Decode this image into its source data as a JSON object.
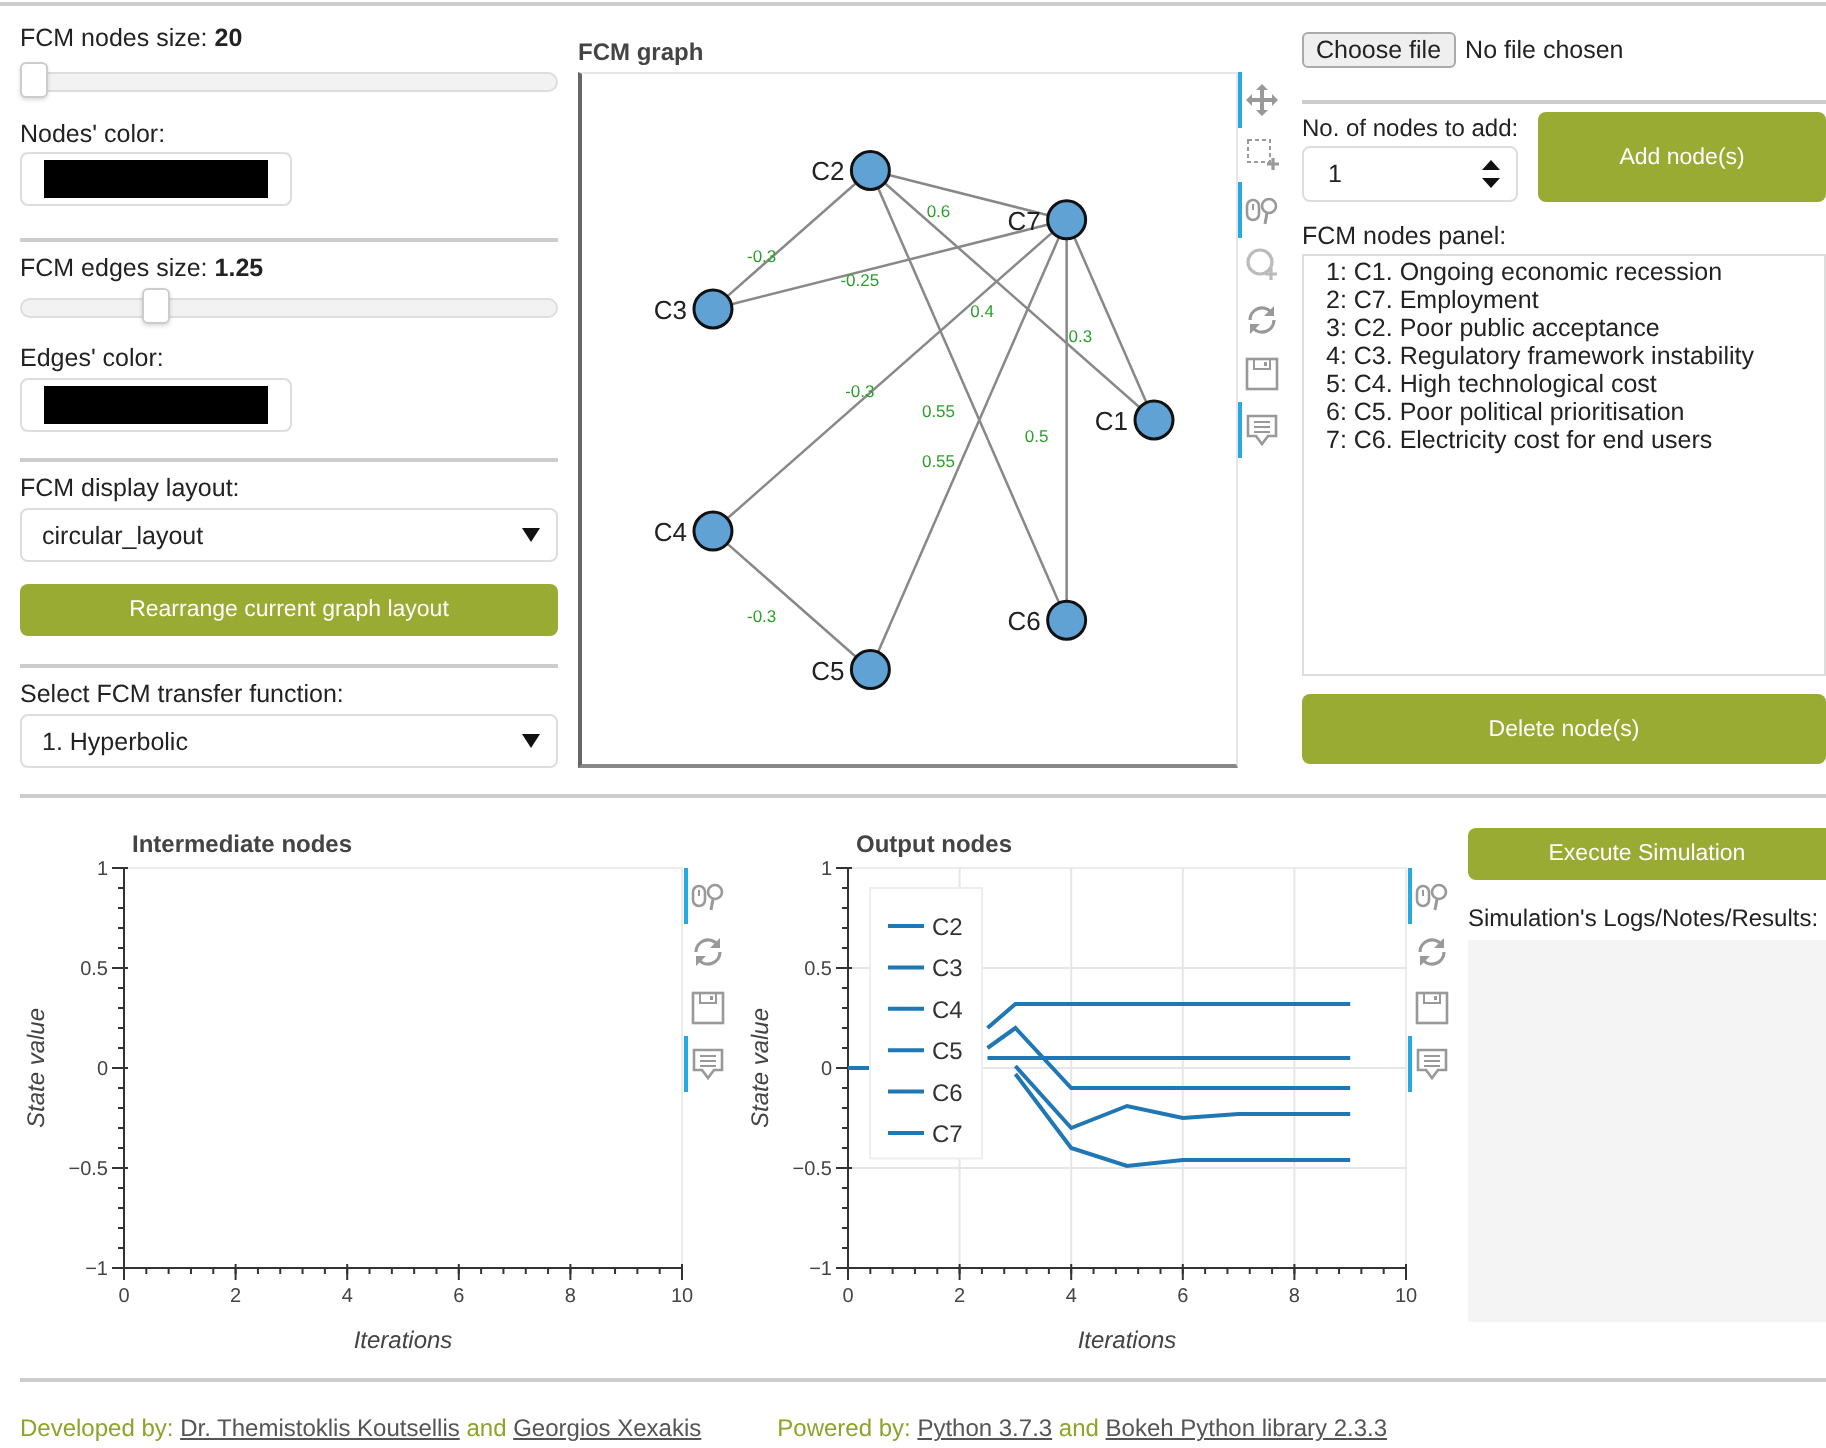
{
  "controls": {
    "node_size": {
      "label": "FCM nodes size: **20**",
      "level": 0.0
    },
    "node_color": {
      "label": "Nodes' color:",
      "color": "#000000"
    },
    "edge_size": {
      "label": "FCM edges size: **1.25**",
      "level": 0.24
    },
    "edge_color": {
      "label": "Edges' color:",
      "color": "#000000"
    },
    "layout": {
      "label": "FCM display layout:",
      "value": "circular_layout"
    },
    "rearrange_button": "Rearrange current graph layout",
    "transfer": {
      "label": "Select FCM transfer function:",
      "value": "1. Hyperbolic"
    }
  },
  "graph": {
    "title": "FCM graph",
    "nodes": [
      {
        "label": "C1"
      },
      {
        "label": "C7"
      },
      {
        "label": "C2"
      },
      {
        "label": "C3"
      },
      {
        "label": "C4"
      },
      {
        "label": "C5"
      },
      {
        "label": "C6"
      }
    ],
    "edges": [
      {
        "label": "-0.3"
      },
      {
        "label": "-0.25"
      },
      {
        "label": "0.6"
      },
      {
        "label": "0.4"
      },
      {
        "label": "0.3"
      },
      {
        "label": "-0.3"
      },
      {
        "label": "0.55"
      },
      {
        "label": "0.55"
      },
      {
        "label": "0.5"
      },
      {
        "label": "-0.3"
      }
    ],
    "tools": [
      {
        "kind": "pan",
        "active": true
      },
      {
        "kind": "box_zoom",
        "active": false
      },
      {
        "kind": "wheel_zoom",
        "active": true
      },
      {
        "kind": "zoom_in",
        "active": false
      },
      {
        "kind": "reset",
        "active": false
      },
      {
        "kind": "save",
        "active": false
      },
      {
        "kind": "hover",
        "active": true
      }
    ]
  },
  "file": {
    "button": "Choose file",
    "status": "No file chosen"
  },
  "add_nodes": {
    "label": "No. of nodes to add:",
    "value": "1",
    "button": "Add node(s)"
  },
  "nodes_panel": {
    "label": "FCM nodes panel:",
    "items": [
      {
        "text": "1: C1. Ongoing economic recession",
        "selected": false
      },
      {
        "text": "2: C7. Employment",
        "selected": false
      },
      {
        "text": "3: C2. Poor public acceptance",
        "selected": false
      },
      {
        "text": "4: C3. Regulatory framework instability",
        "selected": false
      },
      {
        "text": "5: C4. High technological cost",
        "selected": false
      },
      {
        "text": "6: C5. Poor political prioritisation",
        "selected": false
      },
      {
        "text": "7: C6. Electricity cost for end users",
        "selected": false
      }
    ]
  },
  "delete_button": "Delete node(s)",
  "plots": [
    {
      "tools": [
        {
          "kind": "wheel_zoom",
          "active": true
        },
        {
          "kind": "reset",
          "active": false
        },
        {
          "kind": "save",
          "active": false
        },
        {
          "kind": "hover",
          "active": true
        }
      ],
      "chart_data": {
        "type": "line",
        "title": "Intermediate nodes",
        "xlabel": "Iterations",
        "ylabel": "State value",
        "xlim": [
          0,
          10
        ],
        "ylim": [
          -1,
          1
        ],
        "xticks": [
          0,
          2,
          4,
          6,
          8,
          10
        ],
        "yticks": [
          -1,
          -0.5,
          0,
          0.5,
          1
        ]
      }
    },
    {
      "tools": [
        {
          "kind": "wheel_zoom",
          "active": true
        },
        {
          "kind": "reset",
          "active": false
        },
        {
          "kind": "save",
          "active": false
        },
        {
          "kind": "hover",
          "active": true
        }
      ],
      "chart_data": {
        "type": "line",
        "title": "Output nodes",
        "xlabel": "Iterations",
        "ylabel": "State value",
        "xlim": [
          0,
          10
        ],
        "ylim": [
          -1,
          1
        ],
        "xticks": [
          0,
          2,
          4,
          6,
          8,
          10
        ],
        "yticks": [
          -1,
          -0.5,
          0,
          0.5,
          1
        ],
        "grid": true,
        "legend": "top_left",
        "x": [
          0,
          0.4,
          2.5,
          3,
          4,
          5,
          6,
          7,
          8,
          9
        ],
        "series": [
          {
            "name": "C2",
            "color": "#1f77b4",
            "values": [
              null,
              null,
              0.2,
              0.32,
              0.32,
              0.32,
              0.32,
              0.32,
              0.32,
              0.32
            ]
          },
          {
            "name": "C3",
            "color": "#1f77b4",
            "values": [
              null,
              null,
              0.1,
              0.2,
              -0.1,
              -0.1,
              -0.1,
              -0.1,
              -0.1,
              -0.1
            ]
          },
          {
            "name": "C4",
            "color": "#1f77b4",
            "values": [
              null,
              null,
              0.05,
              0.05,
              0.05,
              0.05,
              0.05,
              0.05,
              0.05,
              0.05
            ]
          },
          {
            "name": "C5",
            "color": "#1f77b4",
            "values": [
              null,
              null,
              null,
              0.01,
              -0.3,
              -0.19,
              -0.25,
              -0.23,
              -0.23,
              -0.23
            ]
          },
          {
            "name": "C6",
            "color": "#1f77b4",
            "values": [
              null,
              null,
              null,
              -0.03,
              -0.4,
              -0.49,
              -0.46,
              -0.46,
              -0.46,
              -0.46
            ]
          },
          {
            "name": "C7",
            "color": "#1f77b4",
            "values": [
              0,
              0,
              null,
              null,
              null,
              null,
              null,
              null,
              null,
              null
            ]
          }
        ]
      }
    }
  ],
  "simulation": {
    "button": "Execute Simulation",
    "label": "Simulation's Logs/Notes/Results:"
  },
  "footer": [
    {
      "lead": "Developed by:",
      "joiner": "and",
      "links": [
        "Dr. Themistoklis Koutsellis",
        "Georgios Xexakis"
      ]
    },
    {
      "lead": "Powered by:",
      "joiner": "and",
      "links": [
        "Python 3.7.3",
        "Bokeh Python library 2.3.3"
      ]
    }
  ]
}
